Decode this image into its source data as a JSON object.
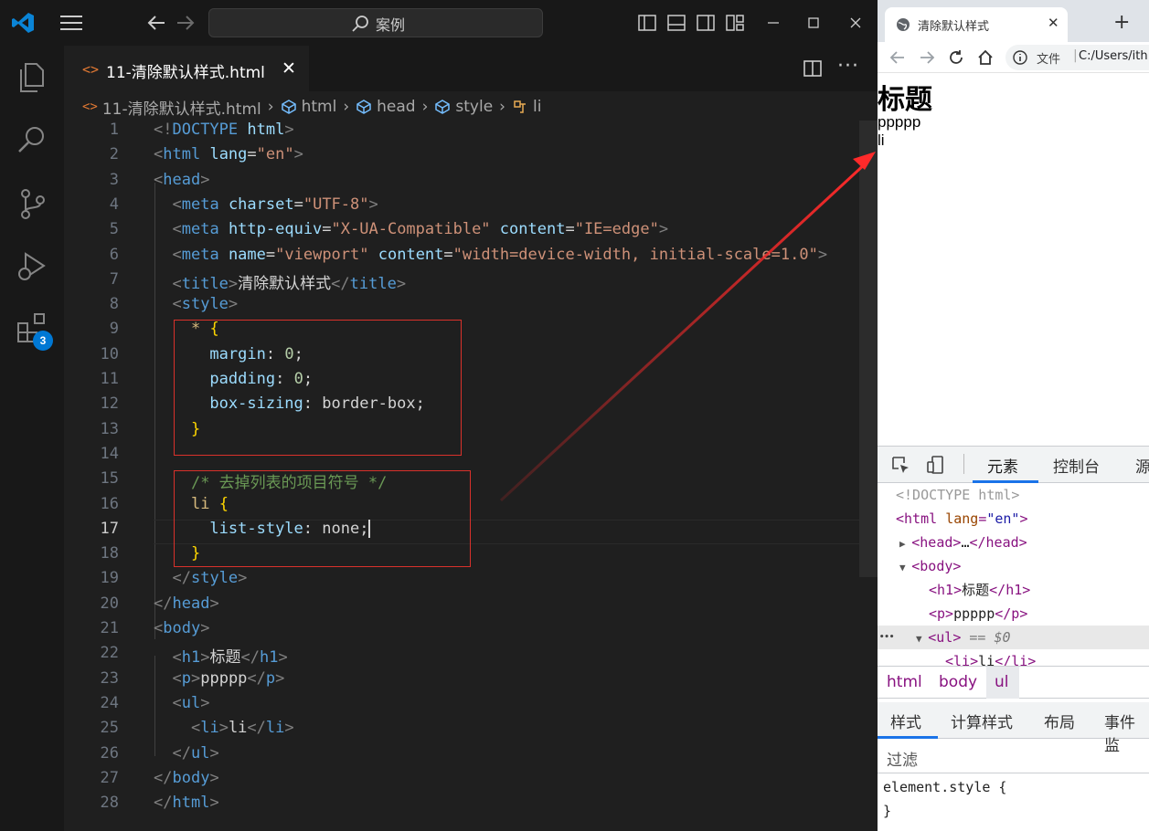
{
  "vscode": {
    "search_text": "案例",
    "tab": {
      "title": "11-清除默认样式.html",
      "icon": "<>",
      "close": "✕"
    },
    "activity_badge": "3",
    "breadcrumb": [
      "11-清除默认样式.html",
      "html",
      "head",
      "style",
      "li"
    ],
    "lines": [
      {
        "n": "1",
        "code": [
          [
            "t-punc",
            "<!"
          ],
          [
            "t-tag",
            "DOCTYPE"
          ],
          [
            "t-text",
            " "
          ],
          [
            "t-attr",
            "html"
          ],
          [
            "t-punc",
            ">"
          ]
        ]
      },
      {
        "n": "2",
        "code": [
          [
            "t-punc",
            "<"
          ],
          [
            "t-tag",
            "html"
          ],
          [
            "t-text",
            " "
          ],
          [
            "t-attr",
            "lang"
          ],
          [
            "t-text",
            "="
          ],
          [
            "t-str",
            "\"en\""
          ],
          [
            "t-punc",
            ">"
          ]
        ]
      },
      {
        "n": "3",
        "code": [
          [
            "t-punc",
            "<"
          ],
          [
            "t-tag",
            "head"
          ],
          [
            "t-punc",
            ">"
          ]
        ]
      },
      {
        "n": "4",
        "code": [
          [
            "t-text",
            "  "
          ],
          [
            "t-punc",
            "<"
          ],
          [
            "t-tag",
            "meta"
          ],
          [
            "t-text",
            " "
          ],
          [
            "t-attr",
            "charset"
          ],
          [
            "t-text",
            "="
          ],
          [
            "t-str",
            "\"UTF-8\""
          ],
          [
            "t-punc",
            ">"
          ]
        ]
      },
      {
        "n": "5",
        "code": [
          [
            "t-text",
            "  "
          ],
          [
            "t-punc",
            "<"
          ],
          [
            "t-tag",
            "meta"
          ],
          [
            "t-text",
            " "
          ],
          [
            "t-attr",
            "http-equiv"
          ],
          [
            "t-text",
            "="
          ],
          [
            "t-str",
            "\"X-UA-Compatible\""
          ],
          [
            "t-text",
            " "
          ],
          [
            "t-attr",
            "content"
          ],
          [
            "t-text",
            "="
          ],
          [
            "t-str",
            "\"IE=edge\""
          ],
          [
            "t-punc",
            ">"
          ]
        ]
      },
      {
        "n": "6",
        "code": [
          [
            "t-text",
            "  "
          ],
          [
            "t-punc",
            "<"
          ],
          [
            "t-tag",
            "meta"
          ],
          [
            "t-text",
            " "
          ],
          [
            "t-attr",
            "name"
          ],
          [
            "t-text",
            "="
          ],
          [
            "t-str",
            "\"viewport\""
          ],
          [
            "t-text",
            " "
          ],
          [
            "t-attr",
            "content"
          ],
          [
            "t-text",
            "="
          ],
          [
            "t-str",
            "\"width=device-width, initial-scale=1.0\""
          ],
          [
            "t-punc",
            ">"
          ]
        ]
      },
      {
        "n": "7",
        "code": [
          [
            "t-text",
            "  "
          ],
          [
            "t-punc",
            "<"
          ],
          [
            "t-tag",
            "title"
          ],
          [
            "t-punc",
            ">"
          ],
          [
            "t-text",
            "清除默认样式"
          ],
          [
            "t-punc",
            "</"
          ],
          [
            "t-tag",
            "title"
          ],
          [
            "t-punc",
            ">"
          ]
        ]
      },
      {
        "n": "8",
        "code": [
          [
            "t-text",
            "  "
          ],
          [
            "t-punc",
            "<"
          ],
          [
            "t-tag",
            "style"
          ],
          [
            "t-punc",
            ">"
          ]
        ]
      },
      {
        "n": "9",
        "code": [
          [
            "t-text",
            "    "
          ],
          [
            "t-sel",
            "*"
          ],
          [
            "t-text",
            " "
          ],
          [
            "t-brace",
            "{"
          ]
        ]
      },
      {
        "n": "10",
        "code": [
          [
            "t-text",
            "      "
          ],
          [
            "t-prop",
            "margin"
          ],
          [
            "t-text",
            ": "
          ],
          [
            "t-num",
            "0"
          ],
          [
            "t-text",
            ";"
          ]
        ]
      },
      {
        "n": "11",
        "code": [
          [
            "t-text",
            "      "
          ],
          [
            "t-prop",
            "padding"
          ],
          [
            "t-text",
            ": "
          ],
          [
            "t-num",
            "0"
          ],
          [
            "t-text",
            ";"
          ]
        ]
      },
      {
        "n": "12",
        "code": [
          [
            "t-text",
            "      "
          ],
          [
            "t-prop",
            "box-sizing"
          ],
          [
            "t-text",
            ": "
          ],
          [
            "t-val",
            "border-box"
          ],
          [
            "t-text",
            ";"
          ]
        ]
      },
      {
        "n": "13",
        "code": [
          [
            "t-text",
            "    "
          ],
          [
            "t-brace",
            "}"
          ]
        ]
      },
      {
        "n": "14",
        "code": []
      },
      {
        "n": "15",
        "code": [
          [
            "t-text",
            "    "
          ],
          [
            "t-comment",
            "/* 去掉列表的项目符号 */"
          ]
        ]
      },
      {
        "n": "16",
        "code": [
          [
            "t-text",
            "    "
          ],
          [
            "t-sel",
            "li"
          ],
          [
            "t-text",
            " "
          ],
          [
            "t-brace",
            "{"
          ]
        ]
      },
      {
        "n": "17",
        "code": [
          [
            "t-text",
            "      "
          ],
          [
            "t-prop",
            "list-style"
          ],
          [
            "t-text",
            ": "
          ],
          [
            "t-val",
            "none"
          ],
          [
            "t-text",
            ";"
          ]
        ]
      },
      {
        "n": "18",
        "code": [
          [
            "t-text",
            "    "
          ],
          [
            "t-brace",
            "}"
          ]
        ]
      },
      {
        "n": "19",
        "code": [
          [
            "t-text",
            "  "
          ],
          [
            "t-punc",
            "</"
          ],
          [
            "t-tag",
            "style"
          ],
          [
            "t-punc",
            ">"
          ]
        ]
      },
      {
        "n": "20",
        "code": [
          [
            "t-punc",
            "</"
          ],
          [
            "t-tag",
            "head"
          ],
          [
            "t-punc",
            ">"
          ]
        ]
      },
      {
        "n": "21",
        "code": [
          [
            "t-punc",
            "<"
          ],
          [
            "t-tag",
            "body"
          ],
          [
            "t-punc",
            ">"
          ]
        ]
      },
      {
        "n": "22",
        "code": [
          [
            "t-text",
            "  "
          ],
          [
            "t-punc",
            "<"
          ],
          [
            "t-tag",
            "h1"
          ],
          [
            "t-punc",
            ">"
          ],
          [
            "t-text",
            "标题"
          ],
          [
            "t-punc",
            "</"
          ],
          [
            "t-tag",
            "h1"
          ],
          [
            "t-punc",
            ">"
          ]
        ]
      },
      {
        "n": "23",
        "code": [
          [
            "t-text",
            "  "
          ],
          [
            "t-punc",
            "<"
          ],
          [
            "t-tag",
            "p"
          ],
          [
            "t-punc",
            ">"
          ],
          [
            "t-text",
            "ppppp"
          ],
          [
            "t-punc",
            "</"
          ],
          [
            "t-tag",
            "p"
          ],
          [
            "t-punc",
            ">"
          ]
        ]
      },
      {
        "n": "24",
        "code": [
          [
            "t-text",
            "  "
          ],
          [
            "t-punc",
            "<"
          ],
          [
            "t-tag",
            "ul"
          ],
          [
            "t-punc",
            ">"
          ]
        ]
      },
      {
        "n": "25",
        "code": [
          [
            "t-text",
            "    "
          ],
          [
            "t-punc",
            "<"
          ],
          [
            "t-tag",
            "li"
          ],
          [
            "t-punc",
            ">"
          ],
          [
            "t-text",
            "li"
          ],
          [
            "t-punc",
            "</"
          ],
          [
            "t-tag",
            "li"
          ],
          [
            "t-punc",
            ">"
          ]
        ]
      },
      {
        "n": "26",
        "code": [
          [
            "t-text",
            "  "
          ],
          [
            "t-punc",
            "</"
          ],
          [
            "t-tag",
            "ul"
          ],
          [
            "t-punc",
            ">"
          ]
        ]
      },
      {
        "n": "27",
        "code": [
          [
            "t-punc",
            "</"
          ],
          [
            "t-tag",
            "body"
          ],
          [
            "t-punc",
            ">"
          ]
        ]
      },
      {
        "n": "28",
        "code": [
          [
            "t-punc",
            "</"
          ],
          [
            "t-tag",
            "html"
          ],
          [
            "t-punc",
            ">"
          ]
        ]
      }
    ],
    "active_line": "17",
    "colors": {
      "annotation": "#d9312b",
      "arrow": "#ff2a2a"
    }
  },
  "browser": {
    "tab_title": "清除默认样式",
    "tab_close": "✕",
    "new_tab": "+",
    "address_label": "文件",
    "url": "C:/Users/ith",
    "page": {
      "h1": "标题",
      "p": "ppppp",
      "li": "li"
    },
    "devtools": {
      "tabs": [
        "元素",
        "控制台",
        "源"
      ],
      "dom": [
        {
          "indent": "1",
          "parts": [
            [
              "d-gray",
              "<!DOCTYPE html>"
            ]
          ]
        },
        {
          "indent": "1",
          "parts": [
            [
              "d-tag",
              "<html "
            ],
            [
              "d-attr",
              "lang"
            ],
            [
              "d-tag",
              "="
            ],
            [
              "d-val",
              "\"en\""
            ],
            [
              "d-tag",
              ">"
            ]
          ]
        },
        {
          "indent": "2",
          "tri": "▶",
          "parts": [
            [
              "d-tag",
              "<head>"
            ],
            [
              "d-text",
              "…"
            ],
            [
              "d-tag",
              "</head>"
            ]
          ]
        },
        {
          "indent": "2",
          "tri": "▼",
          "parts": [
            [
              "d-tag",
              "<body>"
            ]
          ]
        },
        {
          "indent": "3",
          "parts": [
            [
              "d-tag",
              "<h1>"
            ],
            [
              "d-text",
              "标题"
            ],
            [
              "d-tag",
              "</h1>"
            ]
          ]
        },
        {
          "indent": "3",
          "parts": [
            [
              "d-tag",
              "<p>"
            ],
            [
              "d-text",
              "ppppp"
            ],
            [
              "d-tag",
              "</p>"
            ]
          ]
        },
        {
          "indent": "3",
          "tri": "▼",
          "sel": true,
          "dots": "•••",
          "parts": [
            [
              "d-tag",
              "<ul>"
            ],
            [
              "d-eq",
              " == $0"
            ]
          ]
        },
        {
          "indent": "4",
          "parts": [
            [
              "d-tag",
              "<li>"
            ],
            [
              "d-text",
              "li"
            ],
            [
              "d-tag",
              "</li>"
            ]
          ]
        }
      ],
      "crumbs": [
        "html",
        "body",
        "ul"
      ],
      "subtabs": [
        "样式",
        "计算样式",
        "布局",
        "事件监"
      ],
      "filter_placeholder": "过滤",
      "element_style": [
        "element.style {",
        "}"
      ]
    }
  }
}
